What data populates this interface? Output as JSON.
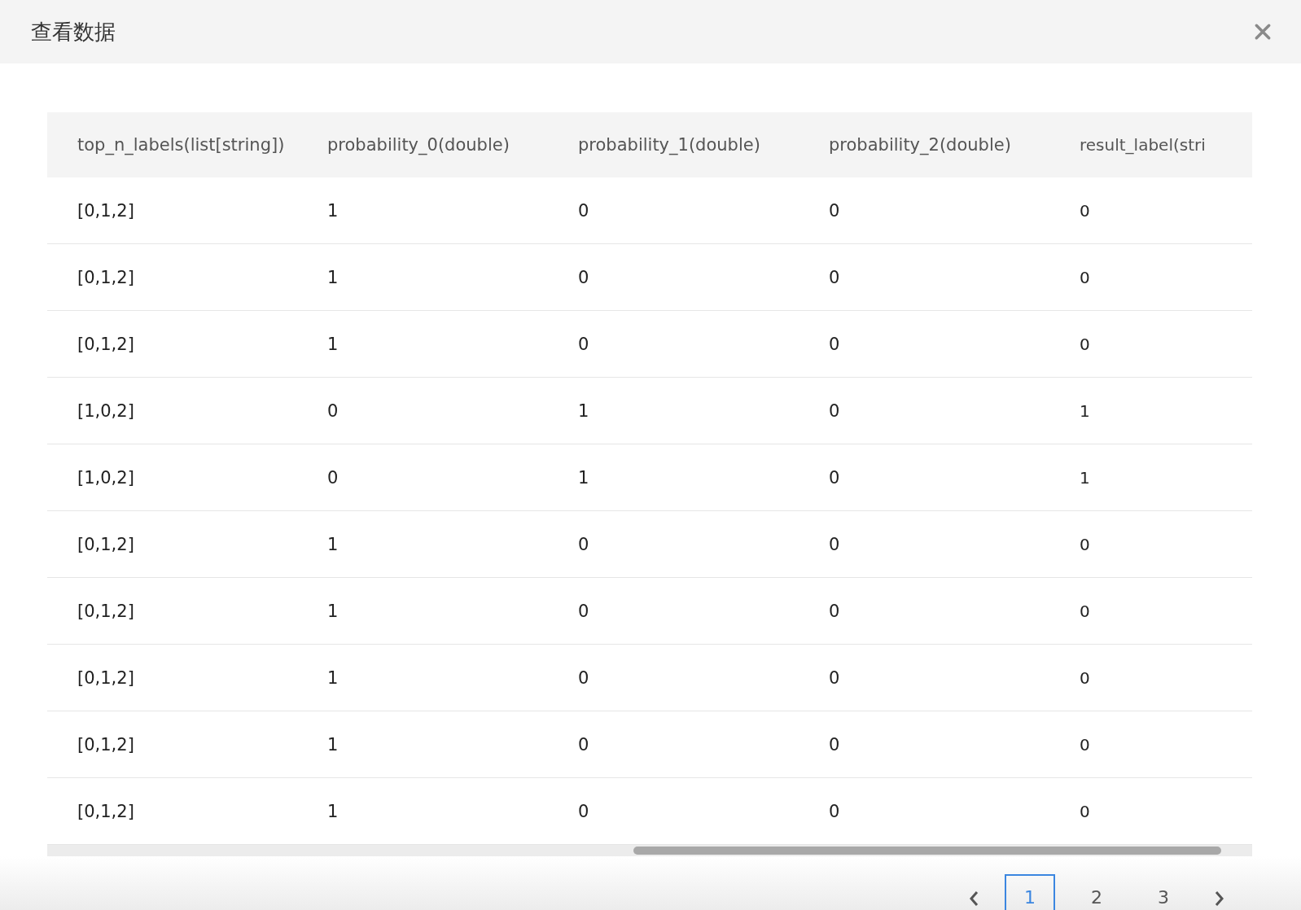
{
  "dialog": {
    "title": "查看数据"
  },
  "table": {
    "columns": [
      "top_n_labels(list[string])",
      "probability_0(double)",
      "probability_1(double)",
      "probability_2(double)",
      "result_label(stri"
    ],
    "rows": [
      [
        "[0,1,2]",
        "1",
        "0",
        "0",
        "0"
      ],
      [
        "[0,1,2]",
        "1",
        "0",
        "0",
        "0"
      ],
      [
        "[0,1,2]",
        "1",
        "0",
        "0",
        "0"
      ],
      [
        "[1,0,2]",
        "0",
        "1",
        "0",
        "1"
      ],
      [
        "[1,0,2]",
        "0",
        "1",
        "0",
        "1"
      ],
      [
        "[0,1,2]",
        "1",
        "0",
        "0",
        "0"
      ],
      [
        "[0,1,2]",
        "1",
        "0",
        "0",
        "0"
      ],
      [
        "[0,1,2]",
        "1",
        "0",
        "0",
        "0"
      ],
      [
        "[0,1,2]",
        "1",
        "0",
        "0",
        "0"
      ],
      [
        "[0,1,2]",
        "1",
        "0",
        "0",
        "0"
      ]
    ]
  },
  "pagination": {
    "pages": [
      {
        "label": "1",
        "selected": true
      },
      {
        "label": "2",
        "selected": false
      },
      {
        "label": "3",
        "selected": false
      }
    ]
  }
}
